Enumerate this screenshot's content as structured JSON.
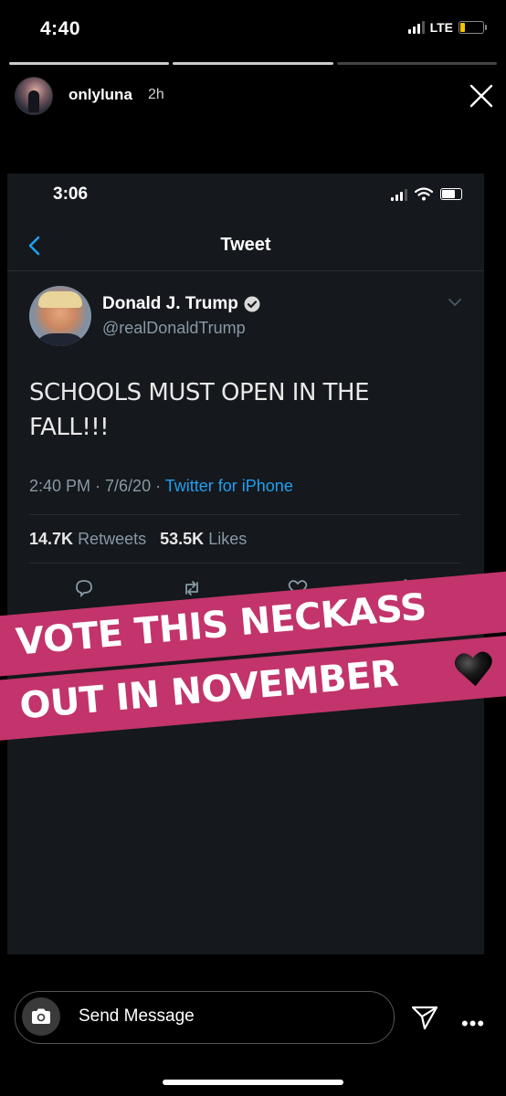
{
  "status_bar": {
    "time": "4:40",
    "network": "LTE"
  },
  "story": {
    "username": "onlyluna",
    "time_ago": "2h",
    "segments_total": 3,
    "segments_done": 2
  },
  "screenshot": {
    "status_time": "3:06",
    "header_title": "Tweet",
    "tweet": {
      "author_name": "Donald J. Trump",
      "author_handle": "@realDonaldTrump",
      "text": "SCHOOLS MUST OPEN IN THE FALL!!!",
      "time": "2:40 PM · 7/6/20 ·",
      "source": "Twitter for iPhone",
      "retweets_count": "14.7K",
      "retweets_label": "Retweets",
      "likes_count": "53.5K",
      "likes_label": "Likes"
    }
  },
  "overlay": {
    "line1": "VOTE THIS NECKASS",
    "line2": "OUT IN NOVEMBER",
    "band_color": "#c2346b"
  },
  "composer": {
    "placeholder": "Send Message"
  },
  "colors": {
    "twitter_blue": "#1da1f2",
    "muted": "#8899a6"
  }
}
